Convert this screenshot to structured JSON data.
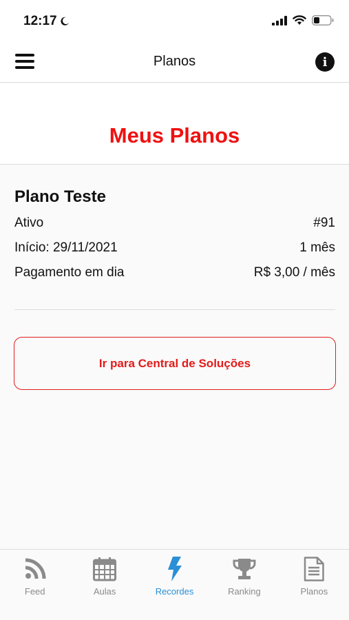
{
  "status": {
    "time": "12:17"
  },
  "nav": {
    "title": "Planos"
  },
  "hero": {
    "title": "Meus Planos"
  },
  "plan": {
    "name": "Plano Teste",
    "rows": [
      {
        "left": "Ativo",
        "right": "#91"
      },
      {
        "left": "Início: 29/11/2021",
        "right": "1 mês"
      },
      {
        "left": "Pagamento em dia",
        "right": "R$ 3,00 / mês"
      }
    ]
  },
  "central_button": {
    "label": "Ir para Central de Soluções"
  },
  "tabs": [
    {
      "label": "Feed",
      "icon": "rss-icon"
    },
    {
      "label": "Aulas",
      "icon": "calendar-icon"
    },
    {
      "label": "Recordes",
      "icon": "lightning-icon",
      "active": true
    },
    {
      "label": "Ranking",
      "icon": "trophy-icon"
    },
    {
      "label": "Planos",
      "icon": "document-icon"
    }
  ],
  "colors": {
    "accent": "#ee1111",
    "tab_active": "#2a8fd6",
    "tab_inactive": "#8a8a8a"
  }
}
